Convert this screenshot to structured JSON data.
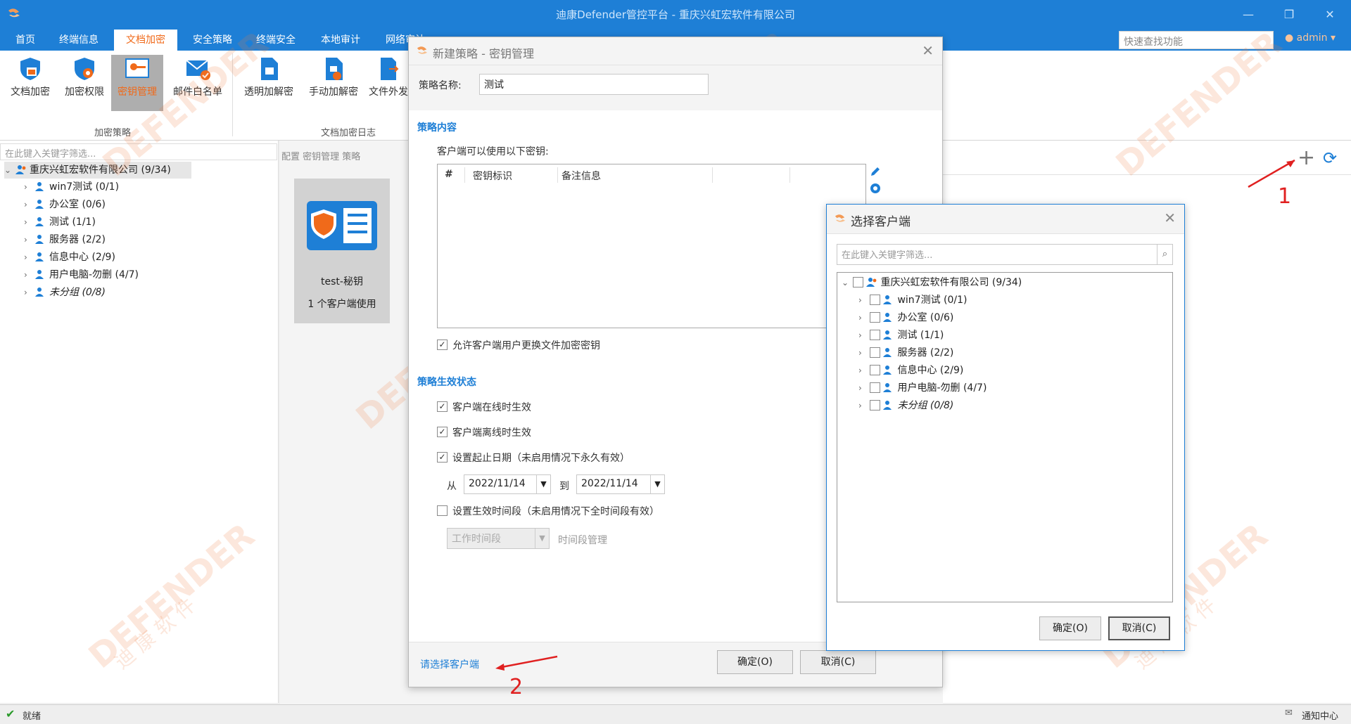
{
  "titlebar": {
    "title": "迪康Defender管控平台 - 重庆兴虹宏软件有限公司",
    "minimize": "—",
    "restore": "❐",
    "close": "✕"
  },
  "menu": {
    "items": [
      "首页",
      "终端信息",
      "文档加密",
      "安全策略",
      "终端安全",
      "本地审计",
      "网络审计"
    ],
    "active_index": 2,
    "quick_search_placeholder": "快速查找功能",
    "user": "admin"
  },
  "ribbon": {
    "buttons": [
      "文档加密",
      "加密权限",
      "密钥管理",
      "邮件白名单",
      "透明加解密",
      "手动加解密",
      "文件外发"
    ],
    "active_button": "密钥管理",
    "groups": [
      "加密策略",
      "文档加密日志"
    ]
  },
  "left_pane": {
    "filter_placeholder": "在此键入关键字筛选...",
    "tree": {
      "root": "重庆兴虹宏软件有限公司 (9/34)",
      "children": [
        "win7测试 (0/1)",
        "办公室 (0/6)",
        "测试 (1/1)",
        "服务器 (2/2)",
        "信息中心 (2/9)",
        "用户电脑-勿删 (4/7)",
        "未分组 (0/8)"
      ]
    }
  },
  "middle_pane": {
    "header": "配置 密钥管理 策略",
    "card": {
      "name": "test-秘钥",
      "usage": "1 个客户端使用"
    }
  },
  "new_policy_dialog": {
    "title": "新建策略 - 密钥管理",
    "policy_name_label": "策略名称:",
    "policy_name_value": "测试",
    "section_content": "策略内容",
    "keys_label": "客户端可以使用以下密钥:",
    "table_headers": [
      "#",
      "密钥标识",
      "备注信息"
    ],
    "allow_change_label": "允许客户端用户更换文件加密密钥",
    "allow_change_checked": true,
    "section_status": "策略生效状态",
    "online_label": "客户端在线时生效",
    "online_checked": true,
    "offline_label": "客户端离线时生效",
    "offline_checked": true,
    "date_label": "设置起止日期（未启用情况下永久有效）",
    "date_checked": true,
    "from_label": "从",
    "from_date": "2022/11/14",
    "to_label": "到",
    "to_date": "2022/11/14",
    "period_label": "设置生效时间段（未启用情况下全时间段有效）",
    "period_checked": false,
    "period_select": "工作时间段",
    "period_manage": "时间段管理",
    "select_clients_link": "请选择客户端",
    "ok": "确定(O)",
    "cancel": "取消(C)",
    "close": "✕"
  },
  "select_client_dialog": {
    "title": "选择客户端",
    "filter_placeholder": "在此键入关键字筛选...",
    "tree": {
      "root": "重庆兴虹宏软件有限公司 (9/34)",
      "children": [
        "win7测试 (0/1)",
        "办公室 (0/6)",
        "测试 (1/1)",
        "服务器 (2/2)",
        "信息中心 (2/9)",
        "用户电脑-勿删 (4/7)",
        "未分组 (0/8)"
      ]
    },
    "ok": "确定(O)",
    "cancel": "取消(C)",
    "close": "✕"
  },
  "toolbar_right": {
    "add": "+",
    "refresh": "⟳"
  },
  "statusbar": {
    "status": "就绪",
    "notify": "通知中心"
  },
  "annotations": {
    "one": "1",
    "two": "2"
  },
  "watermark": {
    "brand": "DEFENDER",
    "chars": "迪 康 软 件"
  },
  "colors": {
    "accent": "#1e7fd6",
    "active_tab": "#f06a1a",
    "annotation": "#e02020"
  }
}
